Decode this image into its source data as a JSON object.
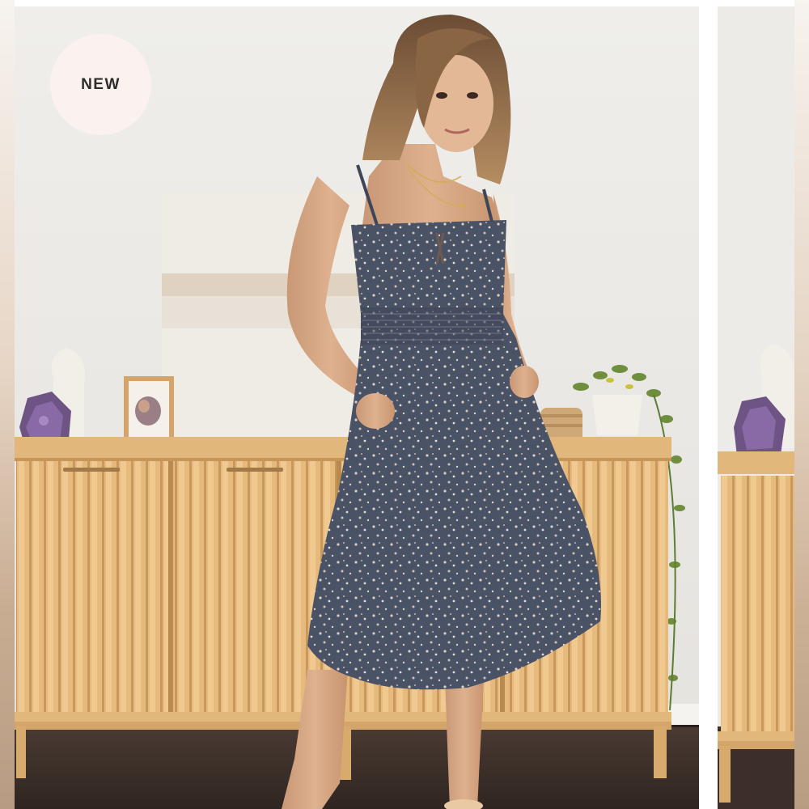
{
  "product_gallery": {
    "badge": {
      "label": "NEW"
    },
    "slides": [
      {
        "icon": "model-in-floral-midi-dress-photo"
      },
      {
        "icon": "sideboard-detail-photo"
      }
    ]
  },
  "colors": {
    "badge_bg": "#fbf1ee",
    "badge_text": "#2d2d2d",
    "wall": "#eceae6",
    "wood": "#e4b77a",
    "dress": "#4a5266"
  }
}
